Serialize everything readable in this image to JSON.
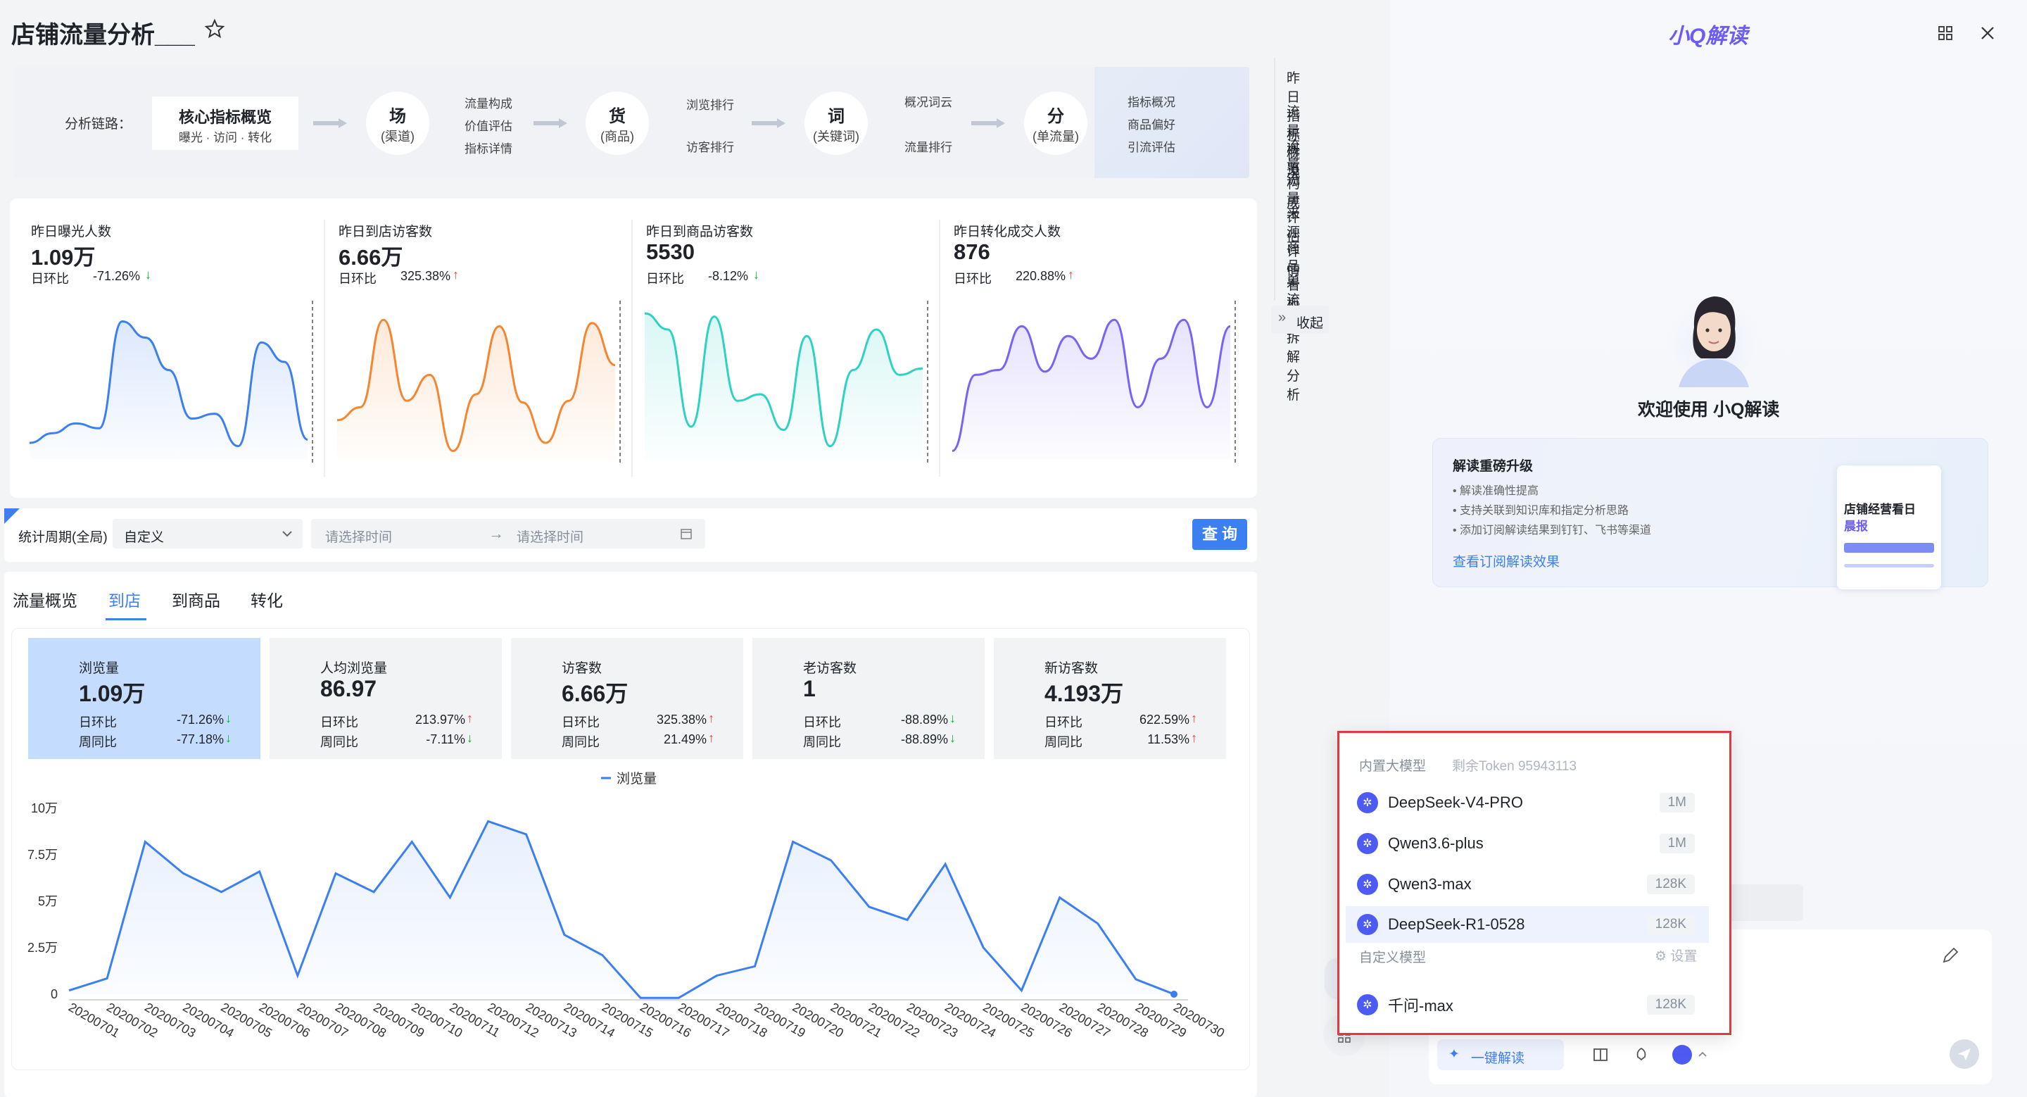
{
  "page_title": "店铺流量分析___",
  "chain": {
    "label": "分析链路：",
    "core_title": "核心指标概览",
    "core_sub": "曝光 · 访问 · 转化",
    "nodes": [
      {
        "big": "场",
        "small": "(渠道)",
        "subs": [
          "流量构成",
          "价值评估",
          "指标详情"
        ]
      },
      {
        "big": "货",
        "small": "(商品)",
        "subs": [
          "浏览排行",
          "访客排行"
        ]
      },
      {
        "big": "词",
        "small": "(关键词)",
        "subs": [
          "概况词云",
          "流量排行"
        ]
      },
      {
        "big": "分",
        "small": "(单流量)",
        "subs": [
          "指标概况",
          "商品偏好",
          "引流评估"
        ]
      }
    ]
  },
  "kpis": [
    {
      "label": "昨日曝光人数",
      "value": "1.09万",
      "rate_label": "日环比",
      "rate": "-71.26%",
      "dir": "down",
      "color": "#3b7ff0"
    },
    {
      "label": "昨日到店访客数",
      "value": "6.66万",
      "rate_label": "日环比",
      "rate": "325.38%",
      "dir": "up",
      "color": "#f5862f"
    },
    {
      "label": "昨日到商品访客数",
      "value": "5530",
      "rate_label": "日环比",
      "rate": "-8.12%",
      "dir": "down",
      "color": "#2ed2c3"
    },
    {
      "label": "昨日转化成交人数",
      "value": "876",
      "rate_label": "日环比",
      "rate": "220.88%",
      "dir": "up",
      "color": "#7b61f5"
    }
  ],
  "filter": {
    "period_label": "统计周期(全局)",
    "period_value": "自定义",
    "start_placeholder": "请选择时间",
    "end_placeholder": "请选择时间",
    "query_button": "查 询"
  },
  "tabs": [
    "流量概览",
    "到店",
    "到商品",
    "转化"
  ],
  "active_tab": "到店",
  "metrics": [
    {
      "title": "浏览量",
      "value": "1.09万",
      "r1_label": "日环比",
      "r1": "-71.26%",
      "r1_dir": "down",
      "r2_label": "周同比",
      "r2": "-77.18%",
      "r2_dir": "down",
      "active": true
    },
    {
      "title": "人均浏览量",
      "value": "86.97",
      "r1_label": "日环比",
      "r1": "213.97%",
      "r1_dir": "up",
      "r2_label": "周同比",
      "r2": "-7.11%",
      "r2_dir": "down"
    },
    {
      "title": "访客数",
      "value": "6.66万",
      "r1_label": "日环比",
      "r1": "325.38%",
      "r1_dir": "up",
      "r2_label": "周同比",
      "r2": "21.49%",
      "r2_dir": "up"
    },
    {
      "title": "老访客数",
      "value": "1",
      "r1_label": "日环比",
      "r1": "-88.89%",
      "r1_dir": "down",
      "r2_label": "周同比",
      "r2": "-88.89%",
      "r2_dir": "down"
    },
    {
      "title": "新访客数",
      "value": "4.193万",
      "r1_label": "日环比",
      "r1": "622.59%",
      "r1_dir": "up",
      "r2_label": "周同比",
      "r2": "11.53%",
      "r2_dir": "up"
    }
  ],
  "chart_data": {
    "type": "area",
    "legend": "浏览量",
    "ytick_labels": [
      "0",
      "2.5万",
      "5万",
      "7.5万",
      "10万"
    ],
    "ylim": [
      0,
      100000
    ],
    "x": [
      "20200701",
      "20200702",
      "20200703",
      "20200704",
      "20200705",
      "20200706",
      "20200707",
      "20200708",
      "20200709",
      "20200710",
      "20200711",
      "20200712",
      "20200713",
      "20200714",
      "20200715",
      "20200716",
      "20200717",
      "20200718",
      "20200719",
      "20200720",
      "20200721",
      "20200722",
      "20200723",
      "20200724",
      "20200725",
      "20200726",
      "20200727",
      "20200728",
      "20200729",
      "20200730"
    ],
    "values": [
      2000,
      8500,
      82000,
      65000,
      55000,
      66000,
      10000,
      65000,
      55000,
      82000,
      52000,
      93000,
      86000,
      32000,
      21000,
      -2000,
      -2000,
      10000,
      15000,
      82000,
      72000,
      47000,
      40000,
      70000,
      25000,
      2000,
      52000,
      38000,
      8000,
      0
    ],
    "color": "#3b7ff0",
    "grid": false
  },
  "side_nav": {
    "items": [
      "昨日指标概况",
      "流量概览",
      "流量构成",
      "流量评估",
      "来源详情",
      "商品看板",
      "单流量拆解分析"
    ],
    "collapse": "收起"
  },
  "assistant": {
    "title": "小Q解读",
    "welcome": "欢迎使用 小Q解读",
    "promo_title": "解读重磅升级",
    "promo_points": [
      "解读准确性提高",
      "支持关联到知识库和指定分析思路",
      "添加订阅解读结果到钉钉、飞书等渠道"
    ],
    "promo_link": "查看订阅解读效果",
    "promo_card_title": "店铺经营看日",
    "promo_card_sub": "晨报",
    "one_click": "一键解读"
  },
  "model_menu": {
    "builtin_label": "内置大模型",
    "token_text": "剩余Token 95943113",
    "builtin": [
      {
        "name": "DeepSeek-V4-PRO",
        "token": "1M"
      },
      {
        "name": "Qwen3.6-plus",
        "token": "1M"
      },
      {
        "name": "Qwen3-max",
        "token": "128K"
      },
      {
        "name": "DeepSeek-R1-0528",
        "token": "128K",
        "selected": true
      }
    ],
    "custom_label": "自定义模型",
    "settings": "设置",
    "custom": [
      {
        "name": "千问-max",
        "token": "128K"
      }
    ],
    "highlight_color": "#e0393e"
  }
}
